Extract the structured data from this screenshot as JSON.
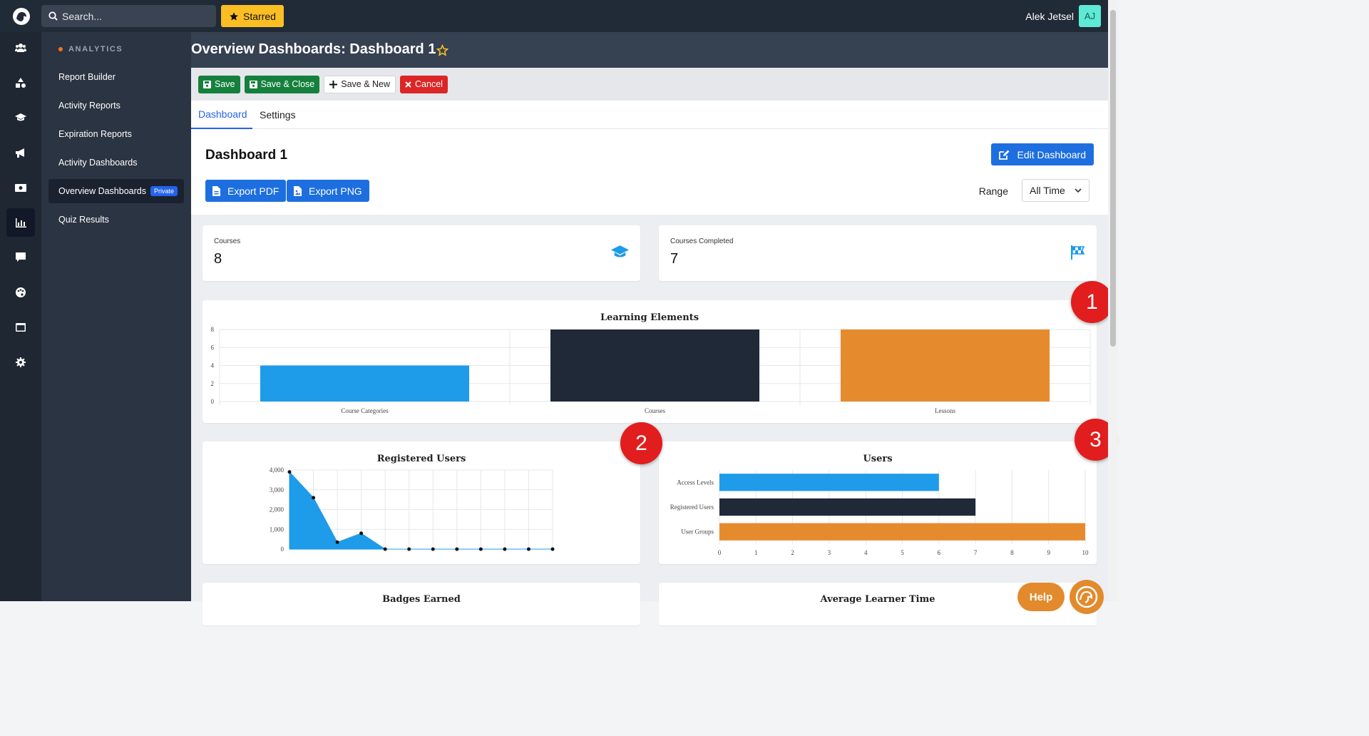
{
  "topbar": {
    "search_placeholder": "Search...",
    "starred_label": "Starred",
    "user_name": "Alek Jetsel",
    "avatar_initials": "AJ"
  },
  "rail": {
    "icons": [
      "users-icon",
      "shapes-icon",
      "graduation-cap-icon",
      "megaphone-icon",
      "money-icon",
      "analytics-chart-icon",
      "message-icon",
      "palette-icon",
      "window-icon",
      "gear-icon"
    ],
    "active": "analytics-chart-icon"
  },
  "subnav": {
    "heading": "ANALYTICS",
    "items": [
      {
        "label": "Report Builder"
      },
      {
        "label": "Activity Reports"
      },
      {
        "label": "Expiration Reports"
      },
      {
        "label": "Activity Dashboards"
      },
      {
        "label": "Overview Dashboards",
        "badge": "Private",
        "active": true
      },
      {
        "label": "Quiz Results"
      }
    ]
  },
  "page": {
    "title": "Overview Dashboards: Dashboard 1"
  },
  "toolbar": {
    "save": "Save",
    "save_close": "Save & Close",
    "save_new": "Save & New",
    "cancel": "Cancel"
  },
  "tabs": [
    {
      "label": "Dashboard",
      "active": true
    },
    {
      "label": "Settings"
    }
  ],
  "dashboard": {
    "title": "Dashboard 1",
    "edit_label": "Edit Dashboard",
    "export_pdf": "Export PDF",
    "export_png": "Export PNG",
    "range_label": "Range",
    "range_value": "All Time"
  },
  "stats": [
    {
      "label": "Courses",
      "value": "8",
      "icon": "graduation-cap-icon"
    },
    {
      "label": "Courses Completed",
      "value": "7",
      "icon": "checkered-flag-icon"
    }
  ],
  "markers": [
    "1",
    "2",
    "3"
  ],
  "help_label": "Help",
  "bottom_cards": [
    "Badges Earned",
    "Average Learner Time"
  ],
  "colors": {
    "blue": "#1e9be9",
    "dark": "#202938",
    "orange": "#e68a2e"
  },
  "chart_data": [
    {
      "type": "bar",
      "title": "Learning Elements",
      "categories": [
        "Course Categories",
        "Courses",
        "Lessons"
      ],
      "values": [
        4,
        8,
        8
      ],
      "ylim": [
        0,
        8
      ],
      "yticks": [
        "0",
        "2",
        "4",
        "6",
        "8"
      ],
      "grid": true
    },
    {
      "type": "area",
      "title": "Registered Users",
      "x_count": 12,
      "values": [
        3900,
        2600,
        350,
        800,
        0,
        0,
        0,
        0,
        0,
        0,
        0,
        0
      ],
      "ylim": [
        0,
        4000
      ],
      "yticks": [
        "0",
        "1,000",
        "2,000",
        "3,000",
        "4,000"
      ],
      "grid": true
    },
    {
      "type": "bar",
      "orientation": "horizontal",
      "title": "Users",
      "categories": [
        "Access Levels",
        "Registered Users",
        "User Groups"
      ],
      "values": [
        6,
        7,
        10
      ],
      "xlim": [
        0,
        10
      ],
      "xticks": [
        "0",
        "1",
        "2",
        "3",
        "4",
        "5",
        "6",
        "7",
        "8",
        "9",
        "10"
      ],
      "grid": true
    }
  ]
}
